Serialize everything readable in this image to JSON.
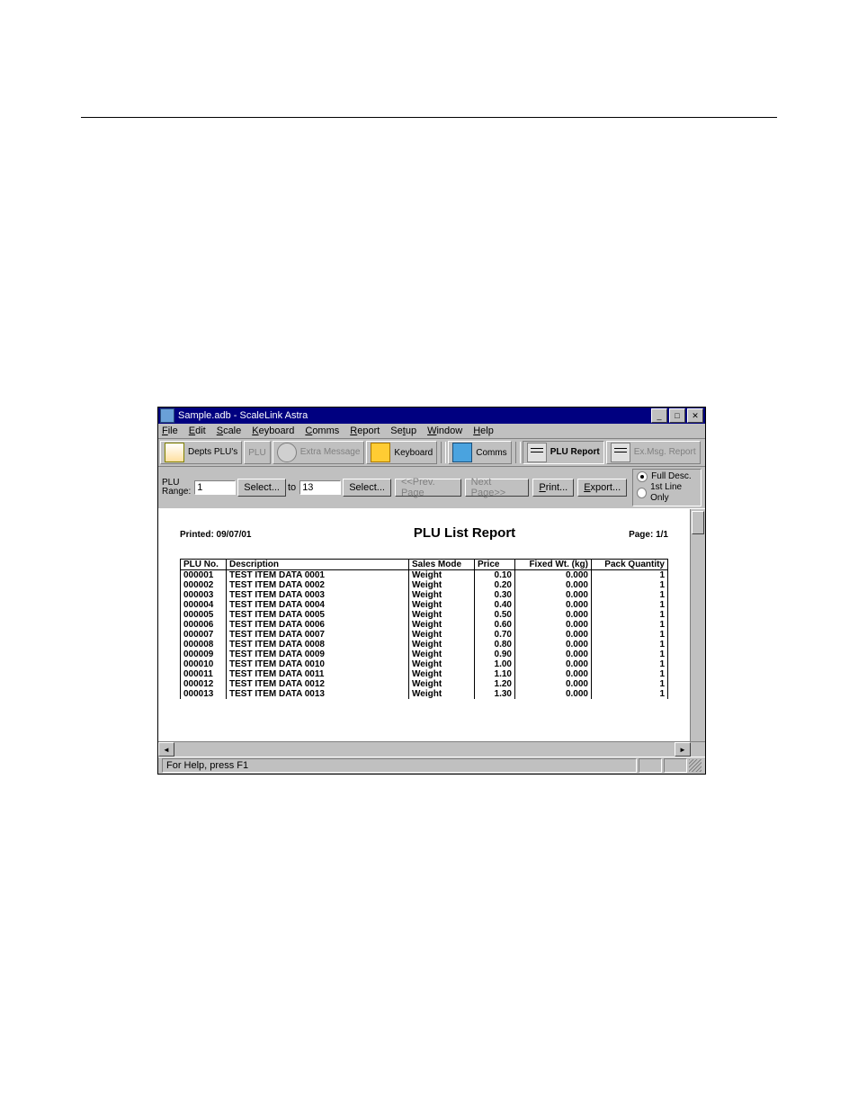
{
  "window": {
    "title": "Sample.adb - ScaleLink Astra"
  },
  "menu": {
    "file": "File",
    "edit": "Edit",
    "scale": "Scale",
    "keyboard": "Keyboard",
    "comms": "Comms",
    "report": "Report",
    "setup": "Setup",
    "window": "Window",
    "help": "Help"
  },
  "toolbar": {
    "depts": "Depts\nPLU's",
    "plu": "PLU",
    "extra_msg": "Extra\nMessage",
    "keyboard": "Keyboard",
    "comms": "Comms",
    "plu_report": "PLU\nReport",
    "exmsg_report": "Ex.Msg.\nReport"
  },
  "range": {
    "label": "PLU\nRange:",
    "from": "1",
    "to_label": "to",
    "to": "13",
    "select": "Select...",
    "prev": "<<Prev. Page",
    "next": "Next Page>>",
    "print": "Print...",
    "export": "Export...",
    "opt_full": "Full Desc.",
    "opt_first": "1st Line Only"
  },
  "report": {
    "printed": "Printed: 09/07/01",
    "title": "PLU List Report",
    "page": "Page: 1/1",
    "headers": {
      "pluno": "PLU No.",
      "desc": "Description",
      "mode": "Sales Mode",
      "price": "Price",
      "wt": "Fixed Wt. (kg)",
      "qty": "Pack Quantity"
    },
    "rows": [
      {
        "pluno": "000001",
        "desc": "TEST ITEM DATA 0001",
        "mode": "Weight",
        "price": "0.10",
        "wt": "0.000",
        "qty": "1"
      },
      {
        "pluno": "000002",
        "desc": "TEST ITEM DATA 0002",
        "mode": "Weight",
        "price": "0.20",
        "wt": "0.000",
        "qty": "1"
      },
      {
        "pluno": "000003",
        "desc": "TEST ITEM DATA 0003",
        "mode": "Weight",
        "price": "0.30",
        "wt": "0.000",
        "qty": "1"
      },
      {
        "pluno": "000004",
        "desc": "TEST ITEM DATA 0004",
        "mode": "Weight",
        "price": "0.40",
        "wt": "0.000",
        "qty": "1"
      },
      {
        "pluno": "000005",
        "desc": "TEST ITEM DATA 0005",
        "mode": "Weight",
        "price": "0.50",
        "wt": "0.000",
        "qty": "1"
      },
      {
        "pluno": "000006",
        "desc": "TEST ITEM DATA 0006",
        "mode": "Weight",
        "price": "0.60",
        "wt": "0.000",
        "qty": "1"
      },
      {
        "pluno": "000007",
        "desc": "TEST ITEM DATA 0007",
        "mode": "Weight",
        "price": "0.70",
        "wt": "0.000",
        "qty": "1"
      },
      {
        "pluno": "000008",
        "desc": "TEST ITEM DATA 0008",
        "mode": "Weight",
        "price": "0.80",
        "wt": "0.000",
        "qty": "1"
      },
      {
        "pluno": "000009",
        "desc": "TEST ITEM DATA 0009",
        "mode": "Weight",
        "price": "0.90",
        "wt": "0.000",
        "qty": "1"
      },
      {
        "pluno": "000010",
        "desc": "TEST ITEM DATA 0010",
        "mode": "Weight",
        "price": "1.00",
        "wt": "0.000",
        "qty": "1"
      },
      {
        "pluno": "000011",
        "desc": "TEST ITEM DATA 0011",
        "mode": "Weight",
        "price": "1.10",
        "wt": "0.000",
        "qty": "1"
      },
      {
        "pluno": "000012",
        "desc": "TEST ITEM DATA 0012",
        "mode": "Weight",
        "price": "1.20",
        "wt": "0.000",
        "qty": "1"
      },
      {
        "pluno": "000013",
        "desc": "TEST ITEM DATA 0013",
        "mode": "Weight",
        "price": "1.30",
        "wt": "0.000",
        "qty": "1"
      }
    ]
  },
  "status": {
    "text": "For Help, press F1"
  }
}
